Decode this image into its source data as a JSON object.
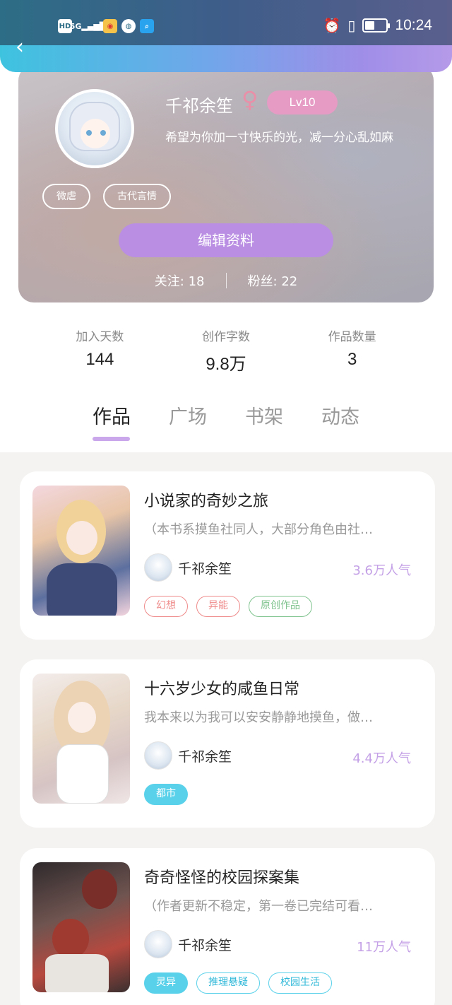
{
  "status_bar": {
    "hd": "HD",
    "signal": "5G",
    "time": "10:24",
    "battery_level": 0.45
  },
  "profile": {
    "name": "千祁余笙",
    "level": "Lv10",
    "bio": "希望为你加一寸快乐的光，减一分心乱如麻",
    "tags": [
      "微虐",
      "古代言情"
    ],
    "edit_label": "编辑资料",
    "following_label": "关注:",
    "following_count": "18",
    "followers_label": "粉丝:",
    "followers_count": "22"
  },
  "stats": [
    {
      "label": "加入天数",
      "value": "144"
    },
    {
      "label": "创作字数",
      "value": "9.8万"
    },
    {
      "label": "作品数量",
      "value": "3"
    }
  ],
  "tabs": [
    "作品",
    "广场",
    "书架",
    "动态"
  ],
  "books": [
    {
      "title": "小说家的奇妙之旅",
      "desc": "（本书系摸鱼社同人，大部分角色由社…",
      "author": "千祁余笙",
      "popularity": "3.6万人气",
      "tags": [
        "幻想",
        "异能",
        "原创作品"
      ]
    },
    {
      "title": "十六岁少女的咸鱼日常",
      "desc": "我本来以为我可以安安静静地摸鱼，做…",
      "author": "千祁余笙",
      "popularity": "4.4万人气",
      "tags": [
        "都市"
      ]
    },
    {
      "title": "奇奇怪怪的校园探案集",
      "desc": "（作者更新不稳定，第一卷已完结可看…",
      "author": "千祁余笙",
      "popularity": "11万人气",
      "tags": [
        "灵异",
        "推理悬疑",
        "校园生活"
      ]
    }
  ]
}
